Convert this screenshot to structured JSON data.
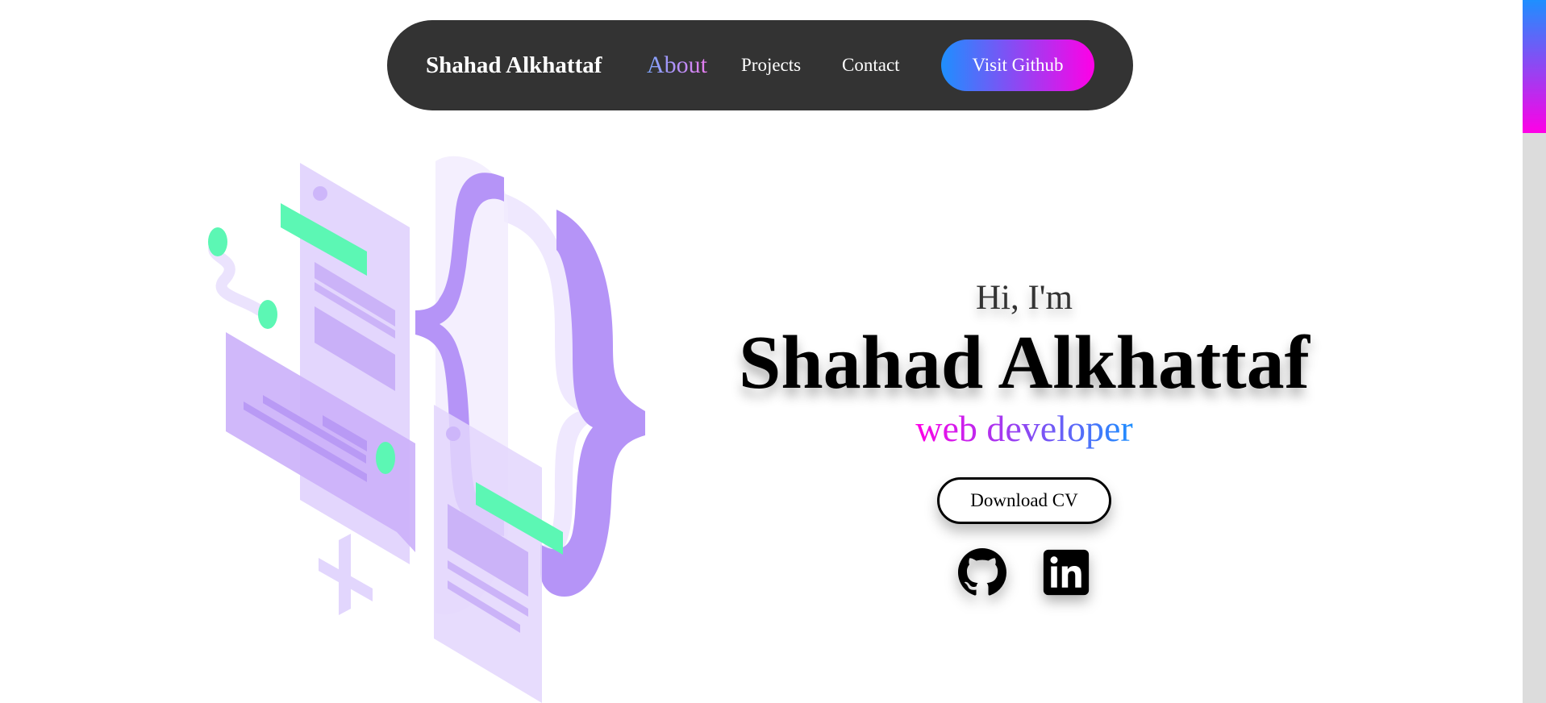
{
  "nav": {
    "brand": "Shahad Alkhattaf",
    "links": [
      {
        "label": "About"
      },
      {
        "label": "Projects"
      },
      {
        "label": "Contact"
      }
    ],
    "cta_label": "Visit Github"
  },
  "hero": {
    "greeting": "Hi, I'm",
    "name": "Shahad Alkhattaf",
    "role": "web developer",
    "cv_label": "Download CV",
    "socials": [
      {
        "icon": "github-icon"
      },
      {
        "icon": "linkedin-icon"
      }
    ]
  },
  "colors": {
    "nav_bg": "#333333",
    "gradient_start": "#1e8fff",
    "gradient_end": "#ff00e6",
    "illustration_purple": "#b694f7",
    "illustration_light": "#e7dbfd",
    "illustration_green": "#5cf7b4"
  }
}
